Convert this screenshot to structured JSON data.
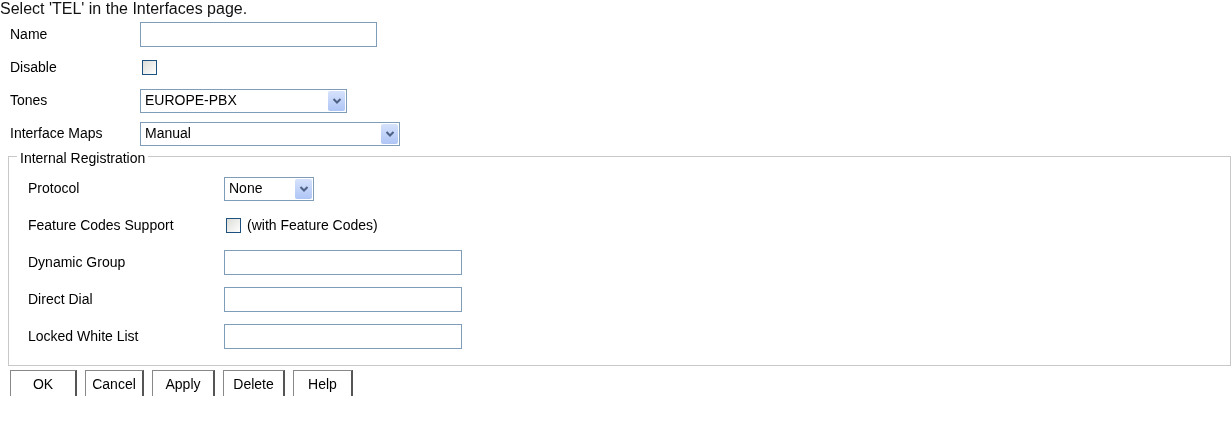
{
  "instruction": "Select 'TEL' in the Interfaces page.",
  "fields": [
    {
      "kind": "text",
      "label": "Name"
    },
    {
      "kind": "checkbox",
      "label": "Disable",
      "checked": false
    },
    {
      "kind": "select",
      "label": "Tones",
      "value": "EUROPE-PBX"
    },
    {
      "kind": "select",
      "label": "Interface Maps",
      "value": "Manual"
    }
  ],
  "group": {
    "legend": "Internal Registration",
    "fields": [
      {
        "kind": "select",
        "label": "Protocol",
        "value": "None"
      },
      {
        "kind": "checkbox",
        "label": "Feature Codes Support",
        "checked": false,
        "note": "(with Feature Codes)"
      },
      {
        "kind": "text",
        "label": "Dynamic Group"
      },
      {
        "kind": "text",
        "label": "Direct Dial"
      },
      {
        "kind": "text",
        "label": "Locked White List"
      }
    ]
  },
  "buttons": [
    "OK",
    "Cancel",
    "Apply",
    "Delete",
    "Help"
  ]
}
